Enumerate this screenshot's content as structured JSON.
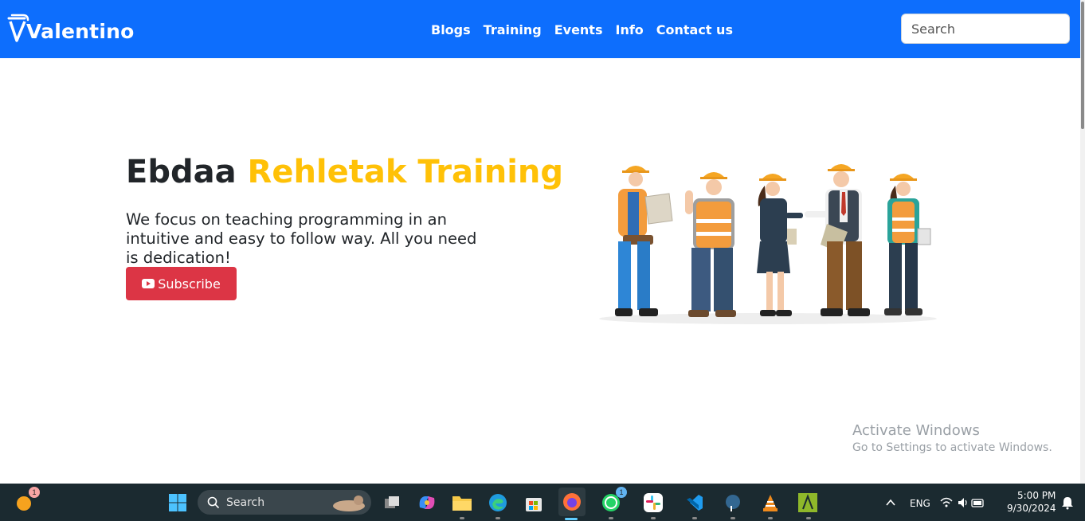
{
  "nav": {
    "brand": "Valentino",
    "links": [
      "Blogs",
      "Training",
      "Events",
      "Info",
      "Contact us"
    ],
    "search_placeholder": "Search"
  },
  "hero": {
    "title_prefix": "Ebdaa",
    "title_accent": "Rehletak Training",
    "description": "We focus on teaching programming in an intuitive and easy to follow way. All you need is dedication!",
    "subscribe_label": "Subscribe"
  },
  "watermark": {
    "title": "Activate Windows",
    "subtitle": "Go to Settings to activate Windows."
  },
  "taskbar": {
    "search_label": "Search",
    "language": "ENG",
    "time": "5:00 PM",
    "date": "9/30/2024",
    "notification_badge": "1",
    "whatsapp_badge": "1"
  },
  "colors": {
    "navbar": "#0d6efd",
    "accent": "#ffc107",
    "subscribe": "#dc3545",
    "taskbar": "#1b2a30"
  }
}
